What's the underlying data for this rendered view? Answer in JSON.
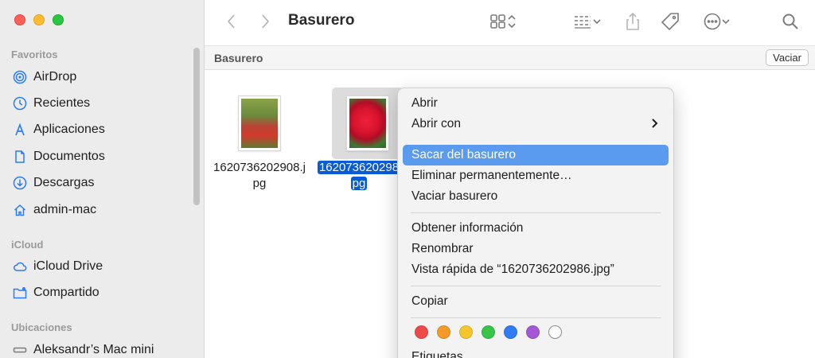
{
  "window": {
    "title": "Basurero"
  },
  "sidebar": {
    "sections": [
      {
        "title": "Favoritos",
        "items": [
          {
            "label": "AirDrop",
            "icon": "airdrop-icon"
          },
          {
            "label": "Recientes",
            "icon": "clock-icon"
          },
          {
            "label": "Aplicaciones",
            "icon": "applications-icon"
          },
          {
            "label": "Documentos",
            "icon": "document-icon"
          },
          {
            "label": "Descargas",
            "icon": "download-icon"
          },
          {
            "label": "admin-mac",
            "icon": "home-icon"
          }
        ]
      },
      {
        "title": "iCloud",
        "items": [
          {
            "label": "iCloud Drive",
            "icon": "cloud-icon"
          },
          {
            "label": "Compartido",
            "icon": "shared-folder-icon"
          }
        ]
      },
      {
        "title": "Ubicaciones",
        "items": [
          {
            "label": "Aleksandr’s Mac mini",
            "icon": "computer-icon"
          }
        ]
      }
    ]
  },
  "pathbar": {
    "label": "Basurero",
    "empty_button": "Vaciar"
  },
  "files": [
    {
      "name_line1": "1620736202908.j",
      "name_line2": "pg",
      "selected": false
    },
    {
      "name_line1": "162073620298",
      "name_line2": "pg",
      "selected": true
    }
  ],
  "context_menu": {
    "items": [
      {
        "label": "Abrir"
      },
      {
        "label": "Abrir con",
        "submenu": true
      },
      {
        "label": "Sacar del basurero",
        "highlighted": true
      },
      {
        "label": "Eliminar permanentemente…"
      },
      {
        "label": "Vaciar basurero"
      },
      {
        "label": "Obtener información"
      },
      {
        "label": "Renombrar"
      },
      {
        "label": "Vista rápida de “1620736202986.jpg”"
      },
      {
        "label": "Copiar"
      },
      {
        "label": "Etiquetas…"
      }
    ],
    "tag_colors": [
      "#ee4a48",
      "#f49a27",
      "#f6c72c",
      "#37c549",
      "#2f7cf6",
      "#a357d6",
      "#ffffff"
    ]
  },
  "colors": {
    "accent": "#2b7cf6",
    "selection": "#0a5bd6",
    "menu_highlight": "#5a9bf0"
  }
}
